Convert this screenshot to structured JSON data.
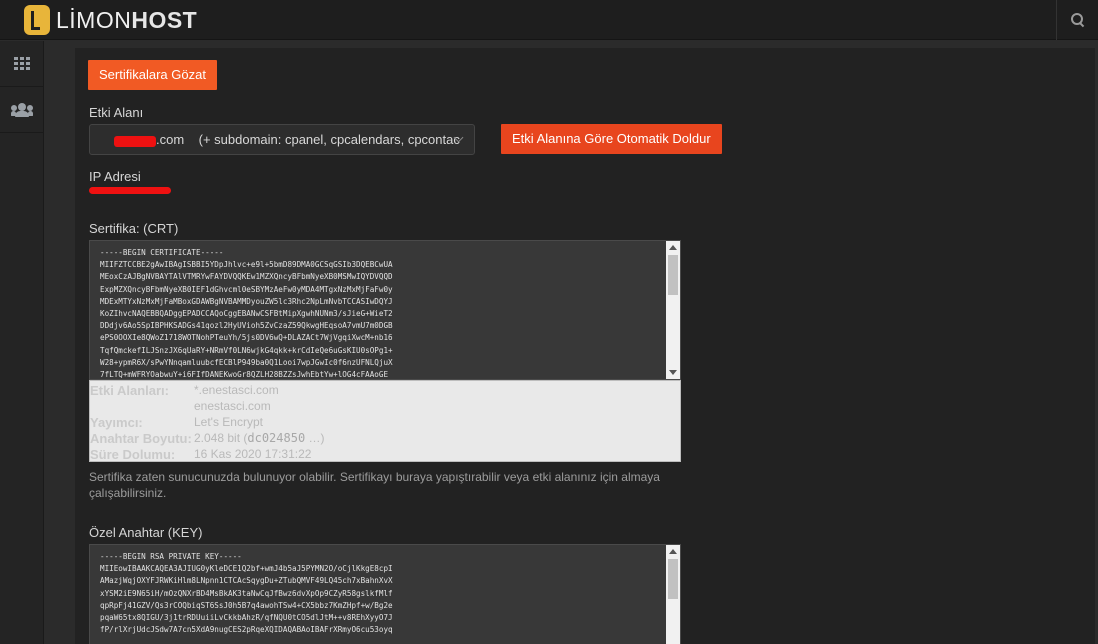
{
  "brand": {
    "name_light": "LİMON",
    "name_bold": "HOST"
  },
  "header": {
    "search_icon": "search-icon"
  },
  "sidebar": {
    "items": [
      {
        "icon": "grid-icon"
      },
      {
        "icon": "users-icon"
      }
    ]
  },
  "buttons": {
    "browse": "Sertifikalara Gözat",
    "autofill": "Etki Alanına Göre Otomatik Doldur"
  },
  "domain": {
    "label": "Etki Alanı",
    "selected_value": ".com    (+ subdomain: cpanel, cpcalendars, cpcontac"
  },
  "ip": {
    "label": "IP Adresi"
  },
  "certificate": {
    "label": "Sertifika: (CRT)",
    "content": "-----BEGIN CERTIFICATE-----\nMIIFZTCCBE2gAwIBAgISBBI5YDpJhlvc+e9l+5bmD89DMA0GCSqGSIb3DQEBCwUA\nMEoxCzAJBgNVBAYTAlVTMRYwFAYDVQQKEw1MZXQncyBFbmNyeXB0MSMwIQYDVQQD\nExpMZXQncyBFbmNyeXB0IEF1dGhvcml0eSBYMzAeFw0yMDA4MTgxNzMxMjFaFw0y\nMDExMTYxNzMxMjFaMBoxGDAWBgNVBAMMDyouZW5lc3Rhc2NpLmNvbTCCASIwDQYJ\nKoZIhvcNAQEBBQADggEPADCCAQoCggEBANwCSFBtMipXgwhNUNm3/sJieG+WieT2\nDDdjv6Ao5SpIBPHKSADGs41qozl2HyUVioh5ZvCzaZ59QkwgHEqsoA7vmU7m0DGB\nePS0OOXIe8QWoZ1718WOTNohPTeuYh/5js0DV6wQ+DLAZACt7WjVgqiXwcM+nb16\nTqfQmckefILJSnzJX6qUaRY+NRmVf0LN6wjkG4qkk+krCdIeQe6uGsKIU0sOPg1+\nW28+ypmR6X/sPwYNnqamluubcfECBlP949ba0Q1Looi7wpJGwIc0f6nzUFNLQjuX\n7fLTQ+mWFRYOabwuY+i6FIfDANEKwoGr8QZLH28BZZsJwhEbtYw+lOG4cFAAoGE"
  },
  "certificate_info": {
    "rows": [
      {
        "key": "Etki Alanları:",
        "value": "*.enestasci.com"
      },
      {
        "key": "",
        "value": "enestasci.com"
      },
      {
        "key": "Yayımcı:",
        "value": "Let's Encrypt"
      },
      {
        "key": "Anahtar Boyutu:",
        "value": "2.048 bit (",
        "mono": "dc024850",
        "suffix": " …)"
      },
      {
        "key": "Süre Dolumu:",
        "value": "16 Kas 2020 17:31:22"
      }
    ]
  },
  "help_text": "Sertifika zaten sunucunuzda bulunuyor olabilir. Sertifikayı buraya yapıştırabilir veya etki alanınız için almaya çalışabilirsiniz.",
  "private_key": {
    "label": "Özel Anahtar (KEY)",
    "content": "-----BEGIN RSA PRIVATE KEY-----\nMIIEowIBAAKCAQEA3AJIUG0yKleDCE1Q2bf+wmJ4b5aJ5PYMN2O/oCjlKkgE8cpI\nAMazjWqjOXYFJRWKiHlm8LNpnn1CTCAcSqygDu+ZTubQMVF49LQ45ch7xBahnXvX\nxYSM2iE9N65iH/mOzQNXrBD4MsBkAK3taNwCqJfBwz6dvXpOp9CZyR58gslkfMlf\nqpRpFj41GZV/Qs3rCOQbiqST6SsJ0h5B7q4awohTSw4+CX5bbz7KmZHpf+w/Bg2e\npqaW65tx8QIGU/3j1trRDUuiiLvCkkbAhzR/qfNQU0tCO5dlJtM++v8REhXyyO7J\nfP/rlXrjUdcJSdw7A7cn5XdA9nugCES2pRqeXQIDAQABAoIBAFrXRmyO6cu53oyq"
  }
}
